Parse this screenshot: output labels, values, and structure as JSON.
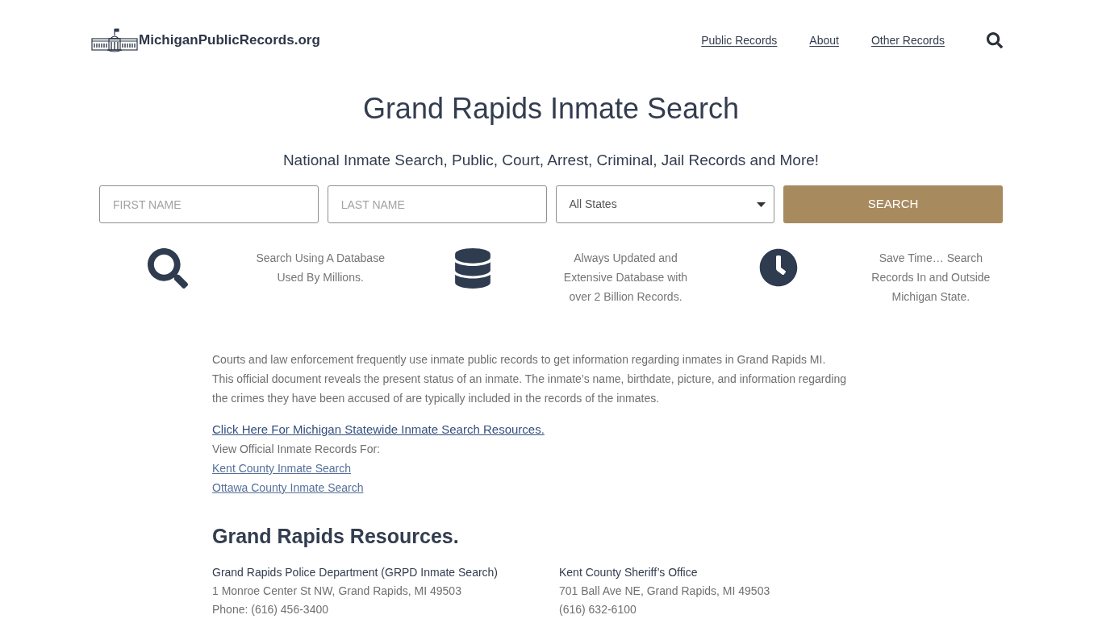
{
  "header": {
    "logo_text": "MichiganPublicRecords.org",
    "nav": [
      "Public Records",
      "About",
      "Other Records"
    ]
  },
  "hero": {
    "title": "Grand Rapids Inmate Search",
    "subtitle": "National Inmate Search, Public, Court, Arrest, Criminal, Jail Records and More!"
  },
  "search_form": {
    "fields": [
      {
        "kind": "text",
        "placeholder": "FIRST NAME"
      },
      {
        "kind": "text",
        "placeholder": "LAST NAME"
      },
      {
        "kind": "select",
        "value": "All States"
      }
    ],
    "button": "SEARCH"
  },
  "features": [
    {
      "kind": "search",
      "lines": [
        "Search Using A Database",
        "Used By Millions."
      ]
    },
    {
      "kind": "database",
      "lines": [
        "Always Updated and",
        "Extensive Database with",
        "over 2 Billion Records."
      ]
    },
    {
      "kind": "clock",
      "lines": [
        "Save Time… Search",
        "Records In and Outside",
        "Michigan State."
      ]
    }
  ],
  "intro": {
    "paragraphs": [
      [
        "Courts and law enforcement frequently use inmate public records to get information regarding inmates in Grand Rapids MI."
      ],
      [
        "This official document reveals the present status of an inmate. The inmate’s name, birthdate, picture, and information regarding",
        "the crimes they have been accused of are typically included in the records of the inmates."
      ]
    ],
    "statewide_link": "Click Here For Michigan Statewide Inmate Search Resources.",
    "view_label": "View Official Inmate Records For:",
    "county_links": [
      "Kent County Inmate Search",
      "Ottawa County Inmate Search"
    ]
  },
  "resources": {
    "title": "Grand Rapids Resources.",
    "offices": [
      {
        "name": "Grand Rapids Police Department (GRPD Inmate Search)",
        "address": "1 Monroe Center St NW, Grand Rapids, MI 49503",
        "phone": "Phone: (616) 456-3400"
      },
      {
        "name": "Kent County Sheriff’s Office",
        "address": "701 Ball Ave NE, Grand Rapids, MI 49503",
        "phone": "(616) 632-6100"
      }
    ]
  }
}
